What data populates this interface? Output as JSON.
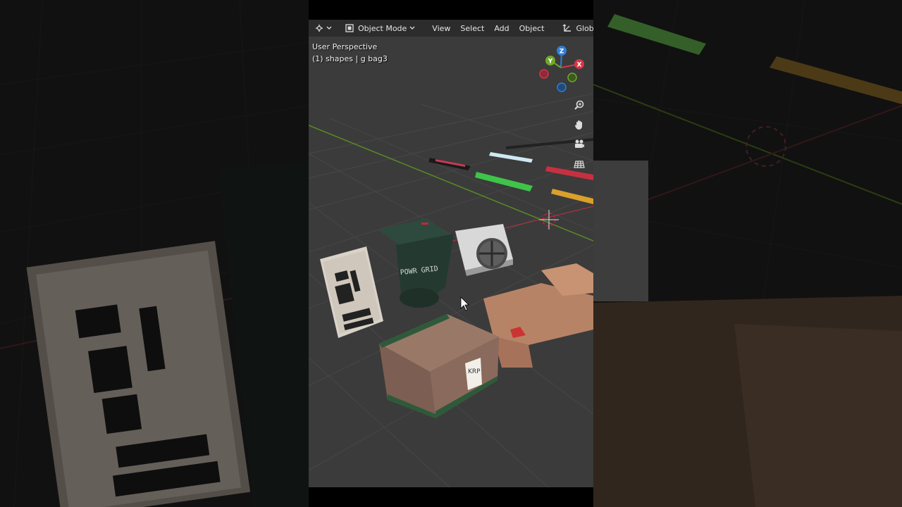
{
  "header": {
    "editor_type_icon": "3d-viewport-icon",
    "mode_label": "Object Mode",
    "menus": [
      "View",
      "Select",
      "Add",
      "Object"
    ],
    "orientation_label": "Global"
  },
  "viewport": {
    "perspective_label": "User Perspective",
    "collection_label": "(1) shapes | g bag3"
  },
  "nav_gizmo": {
    "axes": [
      {
        "label": "Z",
        "color": "#2f7fd8"
      },
      {
        "label": "Y",
        "color": "#6fa82a"
      },
      {
        "label": "X",
        "color": "#d63646"
      }
    ]
  },
  "nav_buttons": [
    "zoom-icon",
    "hand-pan-icon",
    "camera-icon",
    "grid-ortho-icon"
  ],
  "scene_text": {
    "trash_bin": "POWR GRID",
    "box_tag": "KRP"
  },
  "colors": {
    "viewport_bg": "#3b3b3b",
    "grid": "#474747",
    "axis_x": "#a8333f",
    "axis_y": "#5a8a24"
  }
}
